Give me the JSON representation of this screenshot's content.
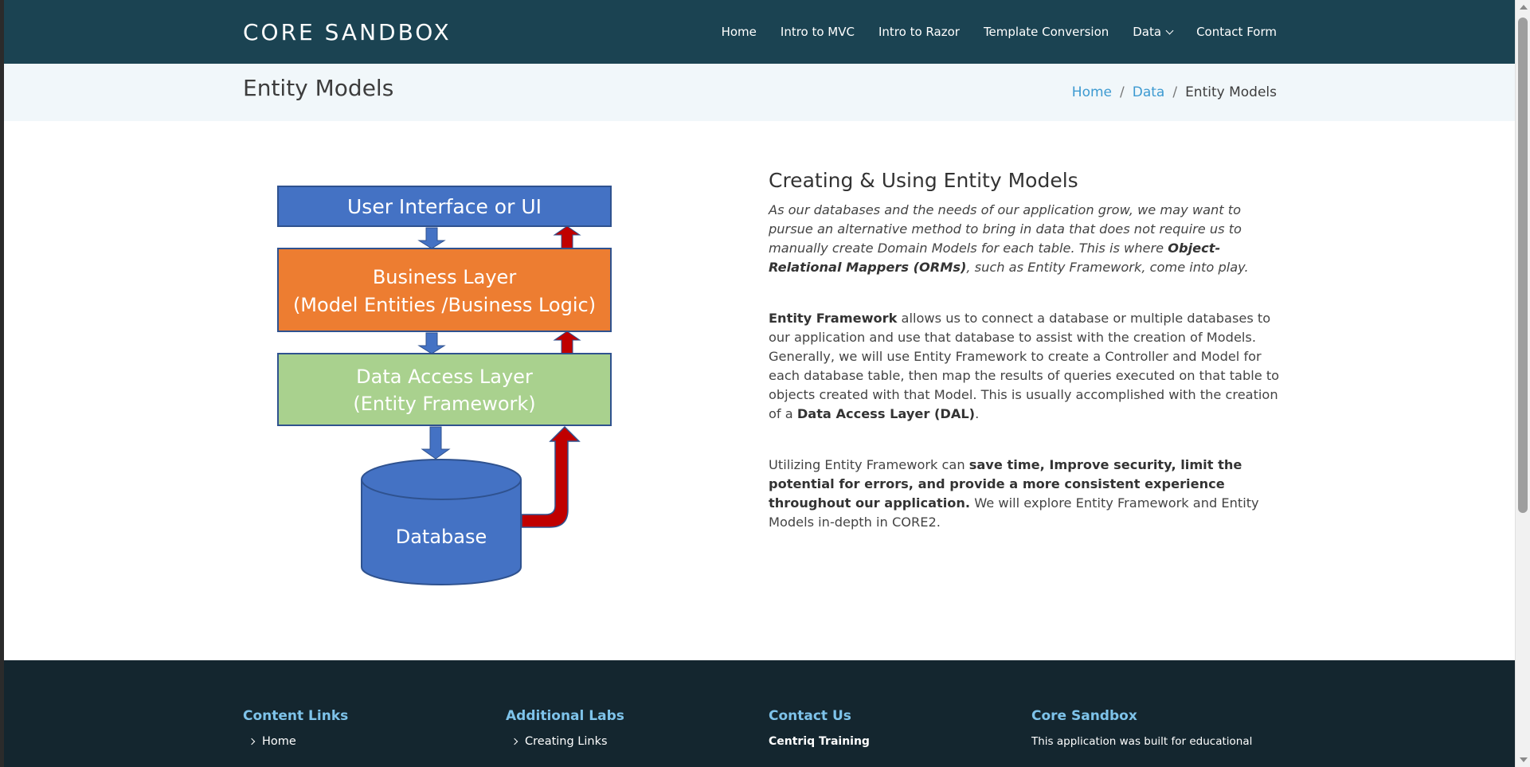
{
  "header": {
    "brand": "CORE SANDBOX",
    "nav": [
      {
        "label": "Home"
      },
      {
        "label": "Intro to MVC"
      },
      {
        "label": "Intro to Razor"
      },
      {
        "label": "Template Conversion"
      },
      {
        "label": "Data"
      },
      {
        "label": "Contact Form"
      }
    ]
  },
  "titlebar": {
    "title": "Entity Models",
    "breadcrumb": [
      "Home",
      "Data",
      "Entity Models"
    ]
  },
  "diagram": {
    "ui_layer": "User Interface or UI",
    "business_line1": "Business Layer",
    "business_line2": "(Model Entities /Business Logic)",
    "dal_line1": "Data Access Layer",
    "dal_line2": "(Entity Framework)",
    "database": "Database",
    "colors": {
      "ui": "#4472c4",
      "business": "#ed7d31",
      "dal": "#a9d18e",
      "database": "#4472c4",
      "arrow_up": "#c00000",
      "arrow_down": "#4472c4"
    }
  },
  "content": {
    "heading": "Creating & Using Entity Models",
    "p1_a": "As our databases and the needs of our application grow, we may want to pursue an alternative method to bring in data that does not require us to manually create Domain Models for each table. This is where ",
    "p1_b": "Object-Relational Mappers (ORMs)",
    "p1_c": ", such as Entity Framework, come into play.",
    "p2_a": "Entity Framework",
    "p2_b": " allows us to connect a database or multiple databases to our application and use that database to assist with the creation of Models. Generally, we will use Entity Framework to create a Controller and Model for each database table, then map the results of queries executed on that table to objects created with that Model. This is usually accomplished with the creation of a ",
    "p2_c": "Data Access Layer (DAL)",
    "p2_d": ".",
    "p3_a": "Utilizing Entity Framework can ",
    "p3_b": "save time, Improve security, limit the potential for errors, and provide a more consistent experience throughout our application.",
    "p3_c": " We will explore Entity Framework and Entity Models in-depth in CORE2."
  },
  "footer": {
    "col1_title": "Content Links",
    "col1_item": "Home",
    "col2_title": "Additional Labs",
    "col2_item": "Creating Links",
    "col3_title": "Contact Us",
    "col3_item": "Centriq Training",
    "col4_title": "Core Sandbox",
    "col4_item": "This application was built for educational"
  }
}
